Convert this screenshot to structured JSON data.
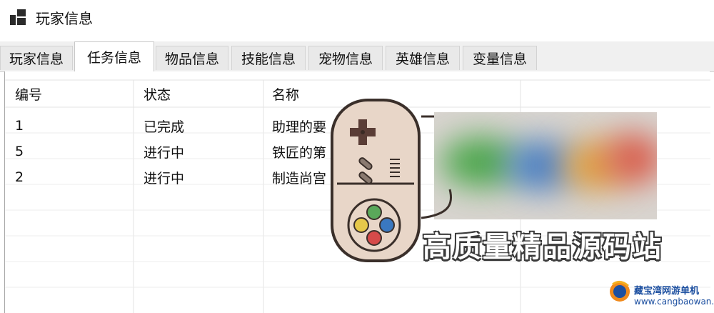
{
  "window": {
    "title": "玩家信息"
  },
  "tabs": [
    {
      "label": "玩家信息"
    },
    {
      "label": "任务信息",
      "active": true
    },
    {
      "label": "物品信息"
    },
    {
      "label": "技能信息"
    },
    {
      "label": "宠物信息"
    },
    {
      "label": "英雄信息"
    },
    {
      "label": "变量信息"
    }
  ],
  "table": {
    "columns": [
      "编号",
      "状态",
      "名称"
    ],
    "rows": [
      {
        "id": "1",
        "status": "已完成",
        "name": "助理的要"
      },
      {
        "id": "5",
        "status": "进行中",
        "name": "铁匠的第"
      },
      {
        "id": "2",
        "status": "进行中",
        "name": "制造尚宫"
      }
    ]
  },
  "overlay": {
    "promo_text": "高质量精品源码站",
    "watermark_line1": "藏宝湾网游单机",
    "watermark_line2": "www.cangbaowan.net"
  },
  "colors": {
    "controller_body": "#e8d6c8",
    "controller_outline": "#3a2f2a",
    "dpad": "#5a3d36",
    "btn_yellow": "#e6c84a",
    "btn_green": "#5aa85a",
    "btn_blue": "#3a78c0",
    "btn_red": "#d64a4a",
    "watermark_blue": "#1c4fa0",
    "watermark_orange": "#f08a1c"
  }
}
